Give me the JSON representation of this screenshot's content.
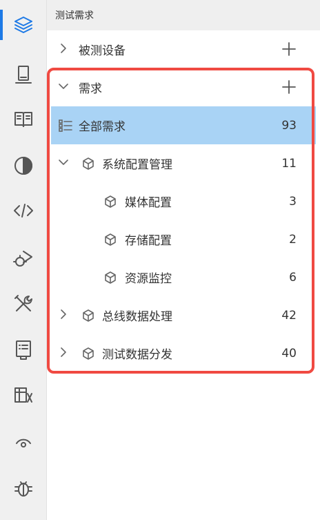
{
  "panel": {
    "title": "测试需求"
  },
  "rail": {
    "icons": [
      "layers-icon",
      "device-icon",
      "book-icon",
      "contrast-icon",
      "code-icon",
      "bug-run-icon",
      "tools-icon",
      "report-icon",
      "folder-table-icon",
      "signal-icon",
      "debug-icon"
    ]
  },
  "tree": {
    "devices": {
      "label": "被测设备"
    },
    "requirements": {
      "label": "需求"
    },
    "all": {
      "label": "全部需求",
      "count": "93"
    },
    "system": {
      "label": "系统配置管理",
      "count": "11"
    },
    "media": {
      "label": "媒体配置",
      "count": "3"
    },
    "storage": {
      "label": "存储配置",
      "count": "2"
    },
    "monitor": {
      "label": "资源监控",
      "count": "6"
    },
    "bus": {
      "label": "总线数据处理",
      "count": "42"
    },
    "dist": {
      "label": "测试数据分发",
      "count": "40"
    }
  },
  "colors": {
    "accent": "#1e7ae6",
    "selected": "#a9d3f5",
    "highlight": "#f04a42"
  }
}
